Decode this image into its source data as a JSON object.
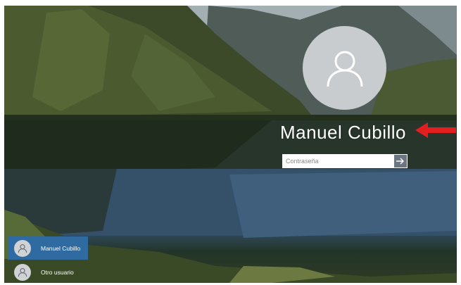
{
  "lock_screen": {
    "user_name": "Manuel Cubillo",
    "password": {
      "placeholder": "Contraseña",
      "value": ""
    },
    "submit_icon": "arrow-right-icon",
    "annotation_arrow_color": "#e31e1e"
  },
  "user_list": {
    "items": [
      {
        "label": "Manuel Cubillo",
        "selected": true,
        "icon": "user-icon"
      },
      {
        "label": "Otro usuario",
        "selected": false,
        "icon": "user-icon"
      }
    ]
  },
  "colors": {
    "selected_user_bg": "#2f6aa1",
    "avatar_bg": "#c9ccce"
  }
}
